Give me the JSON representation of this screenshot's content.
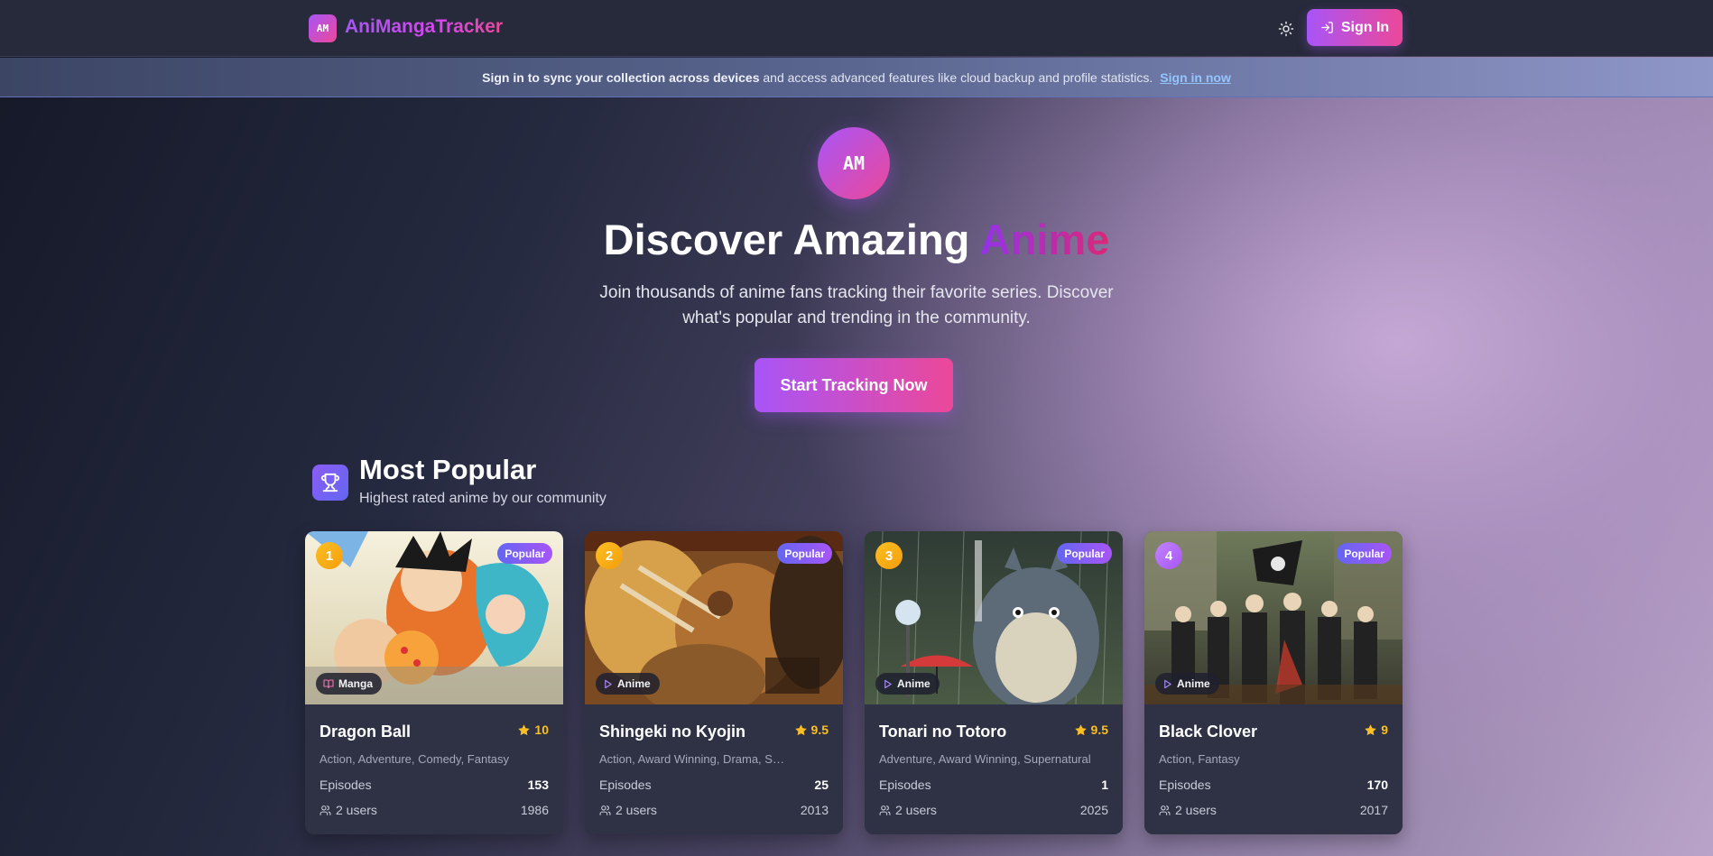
{
  "nav": {
    "logo_badge": "AM",
    "brand": "AniMangaTracker",
    "theme_icon": "sun-icon",
    "signin_label": "Sign In",
    "signin_icon": "log-in-icon"
  },
  "banner": {
    "bold_text": "Sign in to sync your collection across devices",
    "text": "and access advanced features like cloud backup and profile statistics.",
    "link": "Sign in now"
  },
  "hero": {
    "avatar": "AM",
    "title_plain": "Discover Amazing ",
    "title_accent": "Anime",
    "subtitle": "Join thousands of anime fans tracking their favorite series. Discover what's popular and trending in the community.",
    "cta": "Start Tracking Now"
  },
  "section": {
    "icon": "trophy-icon",
    "title": "Most Popular",
    "subtitle": "Highest rated anime by our community"
  },
  "labels": {
    "popular": "Popular",
    "episodes": "Episodes"
  },
  "cards": [
    {
      "rank": "1",
      "title": "Dragon Ball",
      "score": "10",
      "type": "Manga",
      "type_icon": "book-icon",
      "genres": "Action, Adventure, Comedy, Fantasy",
      "episodes": "153",
      "users": "2 users",
      "year": "1986",
      "rank_color": "#f59e0b"
    },
    {
      "rank": "2",
      "title": "Shingeki no Kyojin",
      "score": "9.5",
      "type": "Anime",
      "type_icon": "play-icon",
      "genres": "Action, Award Winning, Drama, Suspense",
      "episodes": "25",
      "users": "2 users",
      "year": "2013",
      "rank_color": "#f59e0b"
    },
    {
      "rank": "3",
      "title": "Tonari no Totoro",
      "score": "9.5",
      "type": "Anime",
      "type_icon": "play-icon",
      "genres": "Adventure, Award Winning, Supernatural",
      "episodes": "1",
      "users": "2 users",
      "year": "2025",
      "rank_color": "#f59e0b"
    },
    {
      "rank": "4",
      "title": "Black Clover",
      "score": "9",
      "type": "Anime",
      "type_icon": "play-icon",
      "genres": "Action, Fantasy",
      "episodes": "170",
      "users": "2 users",
      "year": "2017",
      "rank_color": "#a855f7"
    }
  ],
  "colors": {
    "accent_from": "#a855f7",
    "accent_to": "#ec4899",
    "star": "#fbbf24"
  }
}
